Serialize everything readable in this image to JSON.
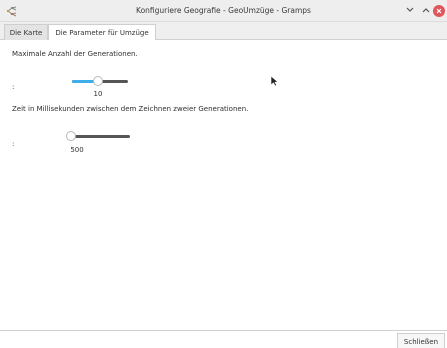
{
  "window": {
    "title": "Konfiguriere Geografie - GeoUmzüge - Gramps",
    "icon": "gramps-tree-icon",
    "controls": [
      "chevron-down-icon",
      "chevron-up-icon",
      "close-icon"
    ],
    "close_color": "#e0575b"
  },
  "tabs": [
    {
      "label": "Die Karte",
      "active": false
    },
    {
      "label": "Die Parameter für Umzüge",
      "active": true
    }
  ],
  "settings": {
    "generations": {
      "label": "Maximale Anzahl der Generationen.",
      "colon": ":",
      "value": "10",
      "level": 0.5
    },
    "delay": {
      "label": "Zeit in Millisekunden zwischen dem Zeichnen zweier Generationen.",
      "colon": ":",
      "value": "500",
      "level": 0.0
    }
  },
  "accent_color": "#3daee9",
  "footer": {
    "close_label": "Schließen"
  }
}
